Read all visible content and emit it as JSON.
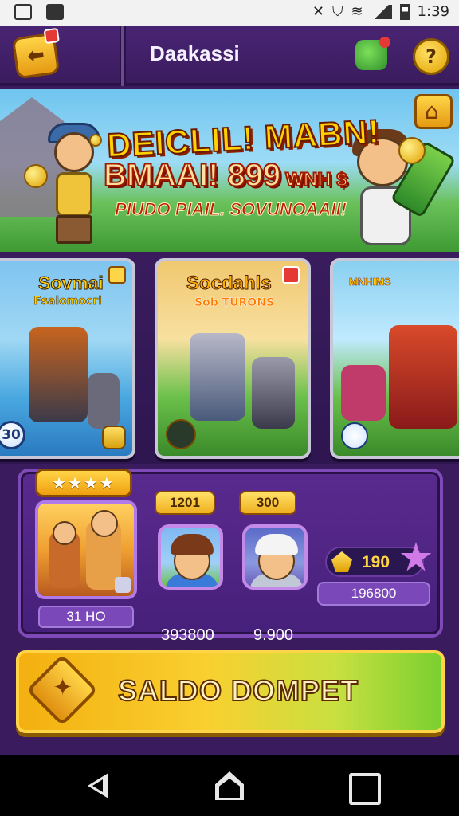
{
  "status_bar": {
    "time": "1:39",
    "icons": [
      "image-icon",
      "nav-icon",
      "mute-icon",
      "shield-icon",
      "wifi-icon",
      "signal-icon",
      "battery-icon"
    ]
  },
  "header": {
    "title": "Daakassi",
    "icons": [
      "back-icon",
      "gift-icon",
      "help-icon"
    ]
  },
  "banner": {
    "line1": "DEICLIL! MABN!",
    "line2": "BMAAI! 899",
    "line2_suffix": "WNH $",
    "line3": "PIUDO PIAIL. SOVUNOAAII!"
  },
  "cards": [
    {
      "title": "Sovmai",
      "subtitle": "Fsalomocri",
      "badge": "30"
    },
    {
      "title": "Socdahls",
      "subtitle": "Sob TURONS"
    },
    {
      "title": "MNHIMS"
    }
  ],
  "panel": {
    "stars": "★★★★",
    "featured_value": "31 HO",
    "tags": [
      "1201",
      "300"
    ],
    "values": [
      "393800",
      "9.900"
    ],
    "coins": "190",
    "coins_sub": "196800"
  },
  "cta": {
    "label": "SALDO DOMPET"
  },
  "colors": {
    "accent": "#f8d030",
    "panel": "#46207a",
    "background": "#3a1c5e"
  }
}
